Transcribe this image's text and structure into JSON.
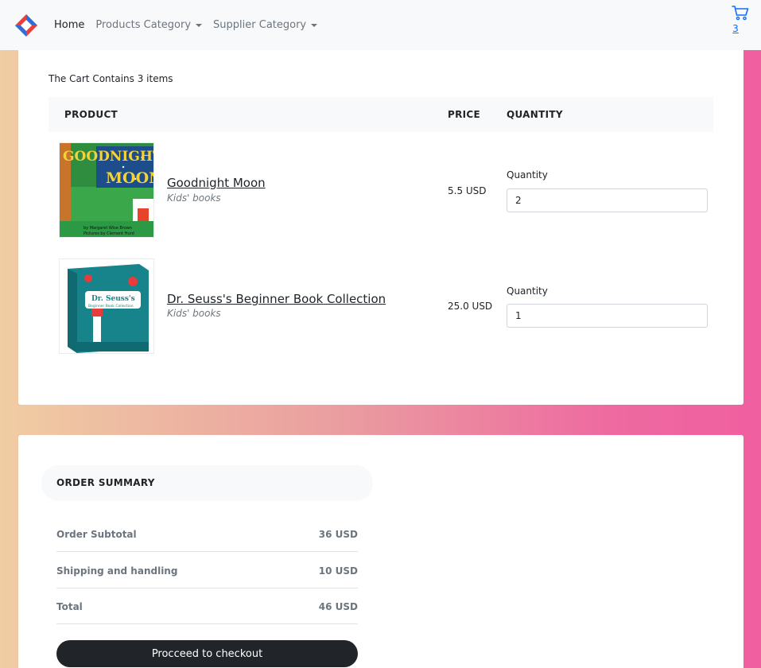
{
  "navbar": {
    "home": "Home",
    "products_category": "Products Category",
    "supplier_category": "Supplier Category",
    "cart_count": "3"
  },
  "cart": {
    "summary_text": "The Cart Contains 3 items",
    "headers": {
      "product": "PRODUCT",
      "price": "PRICE",
      "quantity": "QUANTITY"
    },
    "items": [
      {
        "name": "Goodnight Moon",
        "category": "Kids' books",
        "price": "5.5 USD",
        "quantity_label": "Quantity",
        "quantity": "2"
      },
      {
        "name": "Dr. Seuss's Beginner Book Collection",
        "category": "Kids' books",
        "price": "25.0 USD",
        "quantity_label": "Quantity",
        "quantity": "1"
      }
    ],
    "cover_art": [
      {
        "title_line1": "GOODNIGHT",
        "title_line2": "MOON",
        "credit_line1": "by Margaret Wise Brown",
        "credit_line2": "Pictures by Clement Hurd"
      },
      {
        "title_line1": "Dr. Seuss's",
        "title_line2": "Beginner Book Collection"
      }
    ]
  },
  "summary": {
    "title": "ORDER SUMMARY",
    "rows": [
      {
        "label": "Order Subtotal",
        "value": "36 USD"
      },
      {
        "label": "Shipping and handling",
        "value": "10 USD"
      },
      {
        "label": "Total",
        "value": "46 USD"
      }
    ],
    "checkout_label": "Procceed to checkout"
  },
  "colors": {
    "navbar_bg": "#f8f9fa",
    "link_blue": "#0d6efd",
    "button_dark": "#212529",
    "gradient_left": "#f0cda3",
    "gradient_right": "#f05fa0"
  },
  "icons": {
    "logo": "diamond-logo-icon",
    "cart": "shopping-cart-icon"
  }
}
